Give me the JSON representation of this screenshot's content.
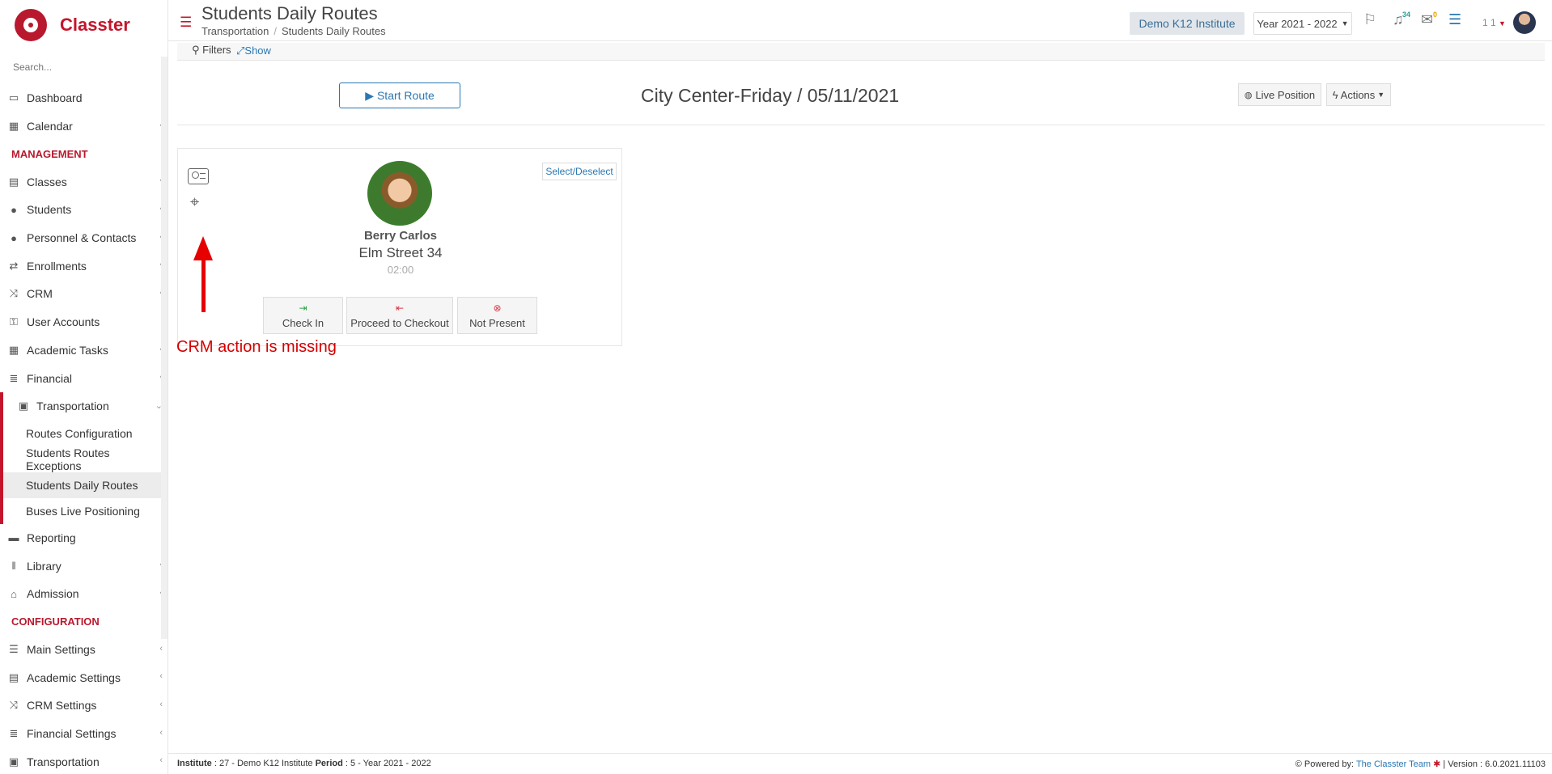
{
  "brand": {
    "name": "Classter"
  },
  "search": {
    "placeholder": "Search..."
  },
  "sidebar": {
    "items_top": [
      {
        "label": "Dashboard",
        "icon": "laptop-icon"
      },
      {
        "label": "Calendar",
        "icon": "calendar-icon"
      }
    ],
    "management_label": "MANAGEMENT",
    "management": [
      {
        "label": "Classes"
      },
      {
        "label": "Students"
      },
      {
        "label": "Personnel & Contacts"
      },
      {
        "label": "Enrollments"
      },
      {
        "label": "CRM"
      },
      {
        "label": "User Accounts"
      },
      {
        "label": "Academic Tasks"
      },
      {
        "label": "Financial"
      }
    ],
    "transportation": {
      "label": "Transportation",
      "sub": [
        {
          "label": "Routes Configuration"
        },
        {
          "label": "Students Routes Exceptions"
        },
        {
          "label": "Students Daily Routes"
        },
        {
          "label": "Buses Live Positioning"
        }
      ]
    },
    "after": [
      {
        "label": "Reporting"
      },
      {
        "label": "Library"
      },
      {
        "label": "Admission"
      }
    ],
    "configuration_label": "CONFIGURATION",
    "configuration": [
      {
        "label": "Main Settings"
      },
      {
        "label": "Academic Settings"
      },
      {
        "label": "CRM Settings"
      },
      {
        "label": "Financial Settings"
      },
      {
        "label": "Transportation"
      }
    ]
  },
  "header": {
    "title": "Students Daily Routes",
    "breadcrumb": [
      "Transportation",
      "Students Daily Routes"
    ],
    "institute": "Demo K12 Institute",
    "year": "Year 2021 - 2022",
    "notifications_count": "34",
    "messages_count": "0",
    "user_label": "1 1"
  },
  "filters": {
    "label": "Filters",
    "show": "Show"
  },
  "route": {
    "start_label": "Start Route",
    "title": "City Center-Friday / 05/11/2021",
    "live_label": "Live Position",
    "actions_label": "Actions"
  },
  "card": {
    "select_label": "Select/Deselect",
    "student_name": "Berry Carlos",
    "address": "Elm Street 34",
    "time": "02:00",
    "actions": [
      {
        "label": "Check In",
        "color": "#28a745"
      },
      {
        "label": "Proceed to Checkout",
        "color": "#dc3545"
      },
      {
        "label": "Not Present",
        "color": "#dc3545"
      }
    ]
  },
  "annotation": {
    "text": "CRM action is missing"
  },
  "footer": {
    "institute_label": "Institute",
    "institute_value": ": 27 - Demo K12 Institute",
    "period_label": "Period",
    "period_value": ": 5 - Year 2021 - 2022",
    "powered_by": "Powered by:",
    "team": "The Classter Team",
    "version": "| Version : 6.0.2021.11103"
  },
  "colors": {
    "brand": "#c3162c",
    "link": "#2a77b2",
    "annotation": "#e60000"
  }
}
